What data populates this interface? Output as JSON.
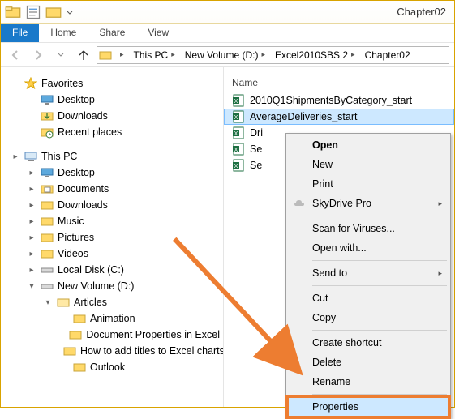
{
  "window": {
    "title": "Chapter02"
  },
  "ribbon": {
    "file": "File",
    "tabs": [
      "Home",
      "Share",
      "View"
    ]
  },
  "breadcrumbs": [
    "This PC",
    "New Volume (D:)",
    "Excel2010SBS 2",
    "Chapter02"
  ],
  "tree": {
    "favorites": {
      "label": "Favorites",
      "items": [
        "Desktop",
        "Downloads",
        "Recent places"
      ]
    },
    "thispc": {
      "label": "This PC",
      "items": [
        "Desktop",
        "Documents",
        "Downloads",
        "Music",
        "Pictures",
        "Videos",
        "Local Disk (C:)"
      ],
      "newvol": {
        "label": "New Volume (D:)",
        "articles": {
          "label": "Articles",
          "items": [
            "Animation",
            "Document Properties in Excel",
            "How to add titles to Excel charts",
            "Outlook"
          ]
        }
      }
    }
  },
  "filepane": {
    "columns": {
      "name": "Name"
    },
    "files": [
      "2010Q1ShipmentsByCategory_start",
      "AverageDeliveries_start",
      "Dri",
      "Se",
      "Se"
    ],
    "selected_index": 1
  },
  "contextmenu": {
    "open": "Open",
    "new": "New",
    "print": "Print",
    "skydrive": "SkyDrive Pro",
    "scan": "Scan for Viruses...",
    "openwith": "Open with...",
    "sendto": "Send to",
    "cut": "Cut",
    "copy": "Copy",
    "shortcut": "Create shortcut",
    "delete": "Delete",
    "rename": "Rename",
    "properties": "Properties"
  }
}
